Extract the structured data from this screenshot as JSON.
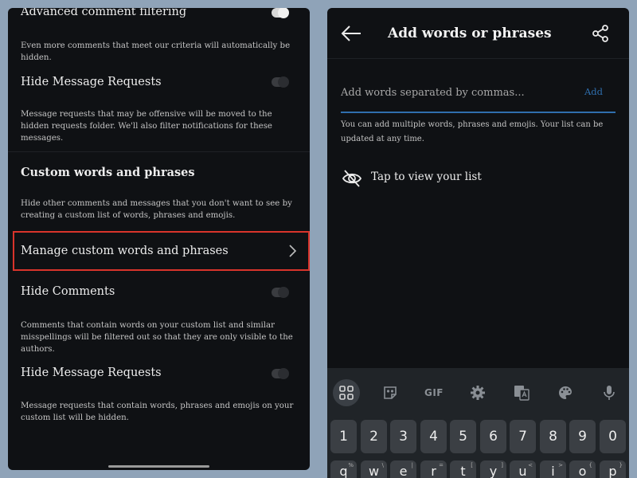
{
  "left": {
    "advanced": {
      "title": "Advanced comment filtering",
      "desc": "Even more comments that meet our criteria will automatically be hidden."
    },
    "hide_requests_1": {
      "title": "Hide Message Requests",
      "desc": "Message requests that may be offensive will be moved to the hidden requests folder. We'll also filter notifications for these messages."
    },
    "custom": {
      "title": "Custom words and phrases",
      "desc": "Hide other comments and messages that you don't want to see by creating a custom list of words, phrases and emojis."
    },
    "manage": {
      "label": "Manage custom words and phrases"
    },
    "hide_comments": {
      "title": "Hide Comments",
      "desc": "Comments that contain words on your custom list and similar misspellings will be filtered out so that they are only visible to the authors."
    },
    "hide_requests_2": {
      "title": "Hide Message Requests",
      "desc": "Message requests that contain words, phrases and emojis on your custom list will be hidden."
    }
  },
  "right": {
    "title": "Add words or phrases",
    "input_placeholder": "Add words separated by commas...",
    "add_label": "Add",
    "desc": "You can add multiple words, phrases and emojis. Your list can be updated at any time.",
    "view_list": "Tap to view your list",
    "keyboard": {
      "gif_label": "GIF",
      "number_row": [
        "1",
        "2",
        "3",
        "4",
        "5",
        "6",
        "7",
        "8",
        "9",
        "0"
      ],
      "second_row": [
        {
          "main": "q",
          "alt": "%"
        },
        {
          "main": "w",
          "alt": "\\"
        },
        {
          "main": "e",
          "alt": "|"
        },
        {
          "main": "r",
          "alt": "="
        },
        {
          "main": "t",
          "alt": "["
        },
        {
          "main": "y",
          "alt": "]"
        },
        {
          "main": "u",
          "alt": "<"
        },
        {
          "main": "i",
          "alt": ">"
        },
        {
          "main": "o",
          "alt": "{"
        },
        {
          "main": "p",
          "alt": "}"
        }
      ]
    }
  },
  "colors": {
    "accent": "#2f6fae",
    "highlight": "#d9342b",
    "background": "#8fa3b8"
  }
}
